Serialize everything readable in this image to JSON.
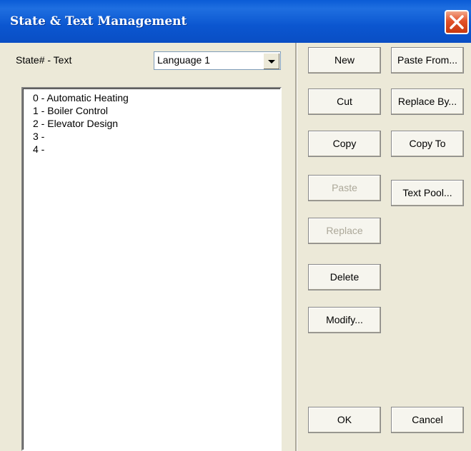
{
  "window": {
    "title": "State & Text Management"
  },
  "header": {
    "state_label": "State# - Text",
    "language_select": {
      "value": "Language 1"
    }
  },
  "list": {
    "items": [
      {
        "label": "0 - Automatic Heating"
      },
      {
        "label": "1 - Boiler Control"
      },
      {
        "label": "2 - Elevator Design"
      },
      {
        "label": "3 -"
      },
      {
        "label": "4 -"
      }
    ]
  },
  "buttons": {
    "new": "New",
    "cut": "Cut",
    "copy": "Copy",
    "paste": "Paste",
    "replace": "Replace",
    "delete": "Delete",
    "modify": "Modify...",
    "paste_from": "Paste From...",
    "replace_by": "Replace By...",
    "copy_to": "Copy To",
    "text_pool": "Text Pool...",
    "ok": "OK",
    "cancel": "Cancel"
  },
  "icons": {
    "close": "close-icon",
    "dropdown": "chevron-down-icon"
  },
  "colors": {
    "titlebar": "#0a5bd6",
    "close": "#e2522a",
    "disabled_text": "#aca899"
  }
}
